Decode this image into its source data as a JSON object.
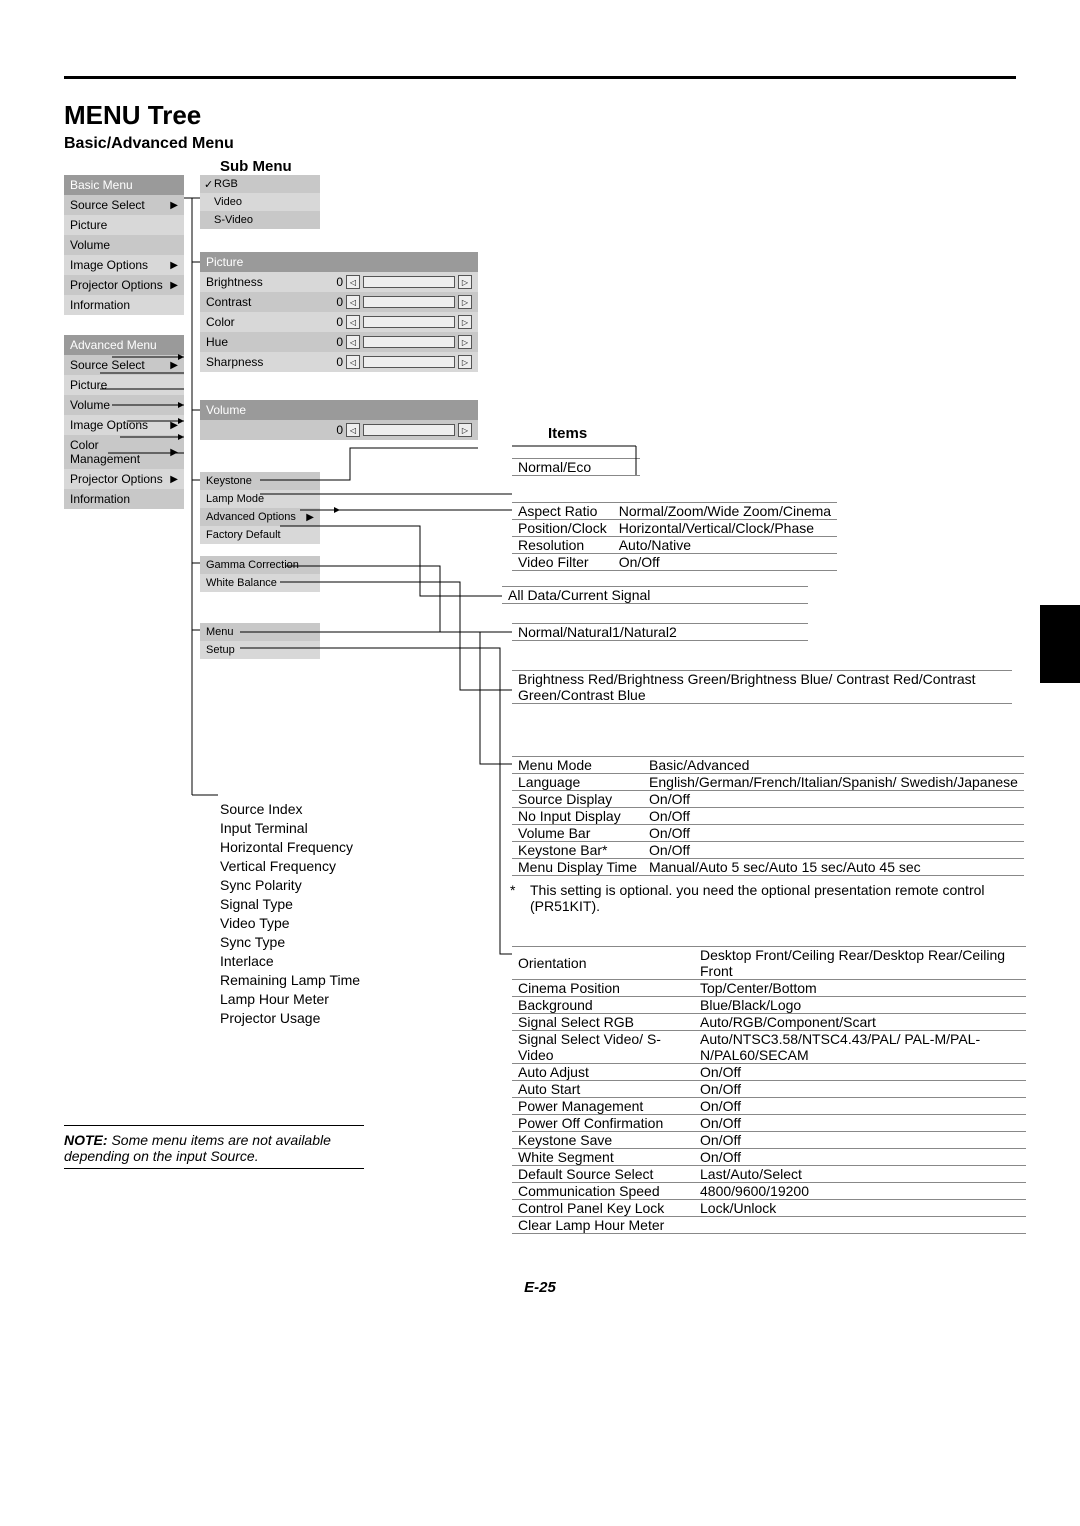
{
  "title": "MENU Tree",
  "subtitle": "Basic/Advanced Menu",
  "submenu_label": "Sub Menu",
  "items_label": "Items",
  "page_number": "E-25",
  "note": {
    "bold": "NOTE:",
    "text": " Some menu items are not available depending on the input Source."
  },
  "basic_menu": {
    "header": "Basic Menu",
    "rows": [
      {
        "label": "Source Select",
        "arrow": true
      },
      {
        "label": "Picture",
        "arrow": false
      },
      {
        "label": "Volume",
        "arrow": false
      },
      {
        "label": "Image Options",
        "arrow": true
      },
      {
        "label": "Projector Options",
        "arrow": true
      },
      {
        "label": "Information",
        "arrow": false
      }
    ]
  },
  "adv_menu": {
    "header": "Advanced Menu",
    "rows": [
      {
        "label": "Source Select",
        "arrow": true
      },
      {
        "label": "Picture",
        "arrow": false
      },
      {
        "label": "Volume",
        "arrow": false
      },
      {
        "label": "Image Options",
        "arrow": true
      },
      {
        "label": "Color Management",
        "arrow": true
      },
      {
        "label": "Projector Options",
        "arrow": true
      },
      {
        "label": "Information",
        "arrow": false
      }
    ]
  },
  "source_sub": {
    "rows": [
      "RGB",
      "Video",
      "S-Video"
    ],
    "checked": 0
  },
  "picture_sub": {
    "header": "Picture",
    "rows": [
      "Brightness",
      "Contrast",
      "Color",
      "Hue",
      "Sharpness"
    ]
  },
  "volume_sub": {
    "header": "Volume"
  },
  "imgopt_sub": {
    "rows": [
      "Keystone",
      "Lamp Mode",
      "Advanced Options",
      "Factory Default"
    ],
    "arrows": [
      false,
      false,
      true,
      false
    ]
  },
  "aop_sub": {
    "rows": [
      "Gamma Correction",
      "White Balance"
    ]
  },
  "prj_sub": {
    "rows": [
      "Menu",
      "Setup"
    ]
  },
  "lamp_mode": "Normal/Eco",
  "advopt_table": [
    [
      "Aspect Ratio",
      "Normal/Zoom/Wide Zoom/Cinema"
    ],
    [
      "Position/Clock",
      "Horizontal/Vertical/Clock/Phase"
    ],
    [
      "Resolution",
      "Auto/Native"
    ],
    [
      "Video Filter",
      "On/Off"
    ]
  ],
  "factory_default": "All Data/Current Signal",
  "gamma": "Normal/Natural1/Natural2",
  "whitebal": "Brightness Red/Brightness Green/Brightness Blue/ Contrast Red/Contrast Green/Contrast Blue",
  "menu_table": [
    [
      "Menu Mode",
      "Basic/Advanced"
    ],
    [
      "Language",
      "English/German/French/Italian/Spanish/ Swedish/Japanese"
    ],
    [
      "Source Display",
      "On/Off"
    ],
    [
      "No Input Display",
      "On/Off"
    ],
    [
      "Volume Bar",
      "On/Off"
    ],
    [
      "Keystone Bar*",
      "On/Off"
    ],
    [
      "Menu Display Time",
      "Manual/Auto 5 sec/Auto 15 sec/Auto 45 sec"
    ]
  ],
  "star_note": "This setting is optional. you need the optional presentation remote control (PR51KIT).",
  "setup_table": [
    [
      "Orientation",
      "Desktop Front/Ceiling Rear/Desktop Rear/Ceiling Front"
    ],
    [
      "Cinema Position",
      "Top/Center/Bottom"
    ],
    [
      "Background",
      "Blue/Black/Logo"
    ],
    [
      "Signal Select RGB",
      "Auto/RGB/Component/Scart"
    ],
    [
      "Signal Select Video/   S-Video",
      "Auto/NTSC3.58/NTSC4.43/PAL/ PAL-M/PAL-N/PAL60/SECAM"
    ],
    [
      "Auto Adjust",
      "On/Off"
    ],
    [
      "Auto Start",
      "On/Off"
    ],
    [
      "Power Management",
      "On/Off"
    ],
    [
      "Power Off Confirmation",
      "On/Off"
    ],
    [
      "Keystone Save",
      "On/Off"
    ],
    [
      "White Segment",
      "On/Off"
    ],
    [
      "Default Source Select",
      "Last/Auto/Select"
    ],
    [
      "Communication Speed",
      "4800/9600/19200"
    ],
    [
      "Control Panel Key Lock",
      "Lock/Unlock"
    ],
    [
      "Clear Lamp Hour Meter",
      ""
    ]
  ],
  "info_list": [
    "Source Index",
    "Input Terminal",
    "Horizontal Frequency",
    "Vertical Frequency",
    "Sync Polarity",
    "Signal Type",
    "Video Type",
    "Sync Type",
    "Interlace",
    "Remaining Lamp Time",
    "Lamp Hour Meter",
    "Projector Usage"
  ]
}
